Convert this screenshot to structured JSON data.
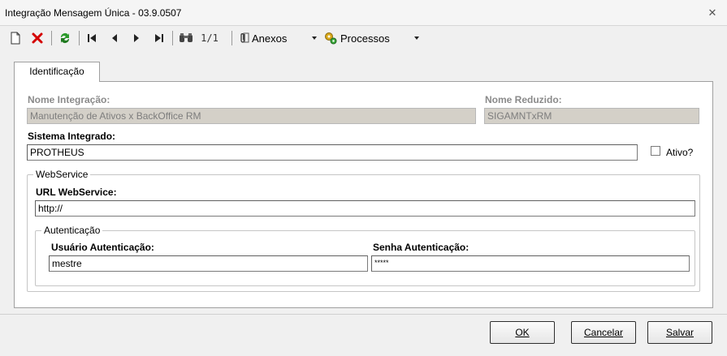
{
  "window": {
    "title": "Integração Mensagem Única - 03.9.0507"
  },
  "toolbar": {
    "record_position": "1/1",
    "anexos_label": "Anexos",
    "processos_label": "Processos"
  },
  "tabs": [
    {
      "label": "Identificação"
    }
  ],
  "form": {
    "nome_integracao": {
      "label": "Nome Integração:",
      "value": "Manutenção de Ativos x BackOffice RM"
    },
    "nome_reduzido": {
      "label": "Nome Reduzido:",
      "value": "SIGAMNTxRM"
    },
    "sistema_integrado": {
      "label": "Sistema Integrado:",
      "value": "PROTHEUS"
    },
    "ativo": {
      "label": "Ativo?",
      "checked": false
    },
    "webservice": {
      "legend": "WebService",
      "url": {
        "label": "URL WebService:",
        "value": "http://"
      },
      "autenticacao": {
        "legend": "Autenticação",
        "usuario": {
          "label": "Usuário Autenticação:",
          "value": "mestre"
        },
        "senha": {
          "label": "Senha Autenticação:",
          "value": "*****"
        }
      }
    }
  },
  "buttons": {
    "ok": "OK",
    "cancelar": "Cancelar",
    "salvar": "Salvar"
  },
  "colors": {
    "disabled_field_bg": "#d4d0c8",
    "refresh_green": "#2a9a2a",
    "delete_red": "#d40000"
  }
}
